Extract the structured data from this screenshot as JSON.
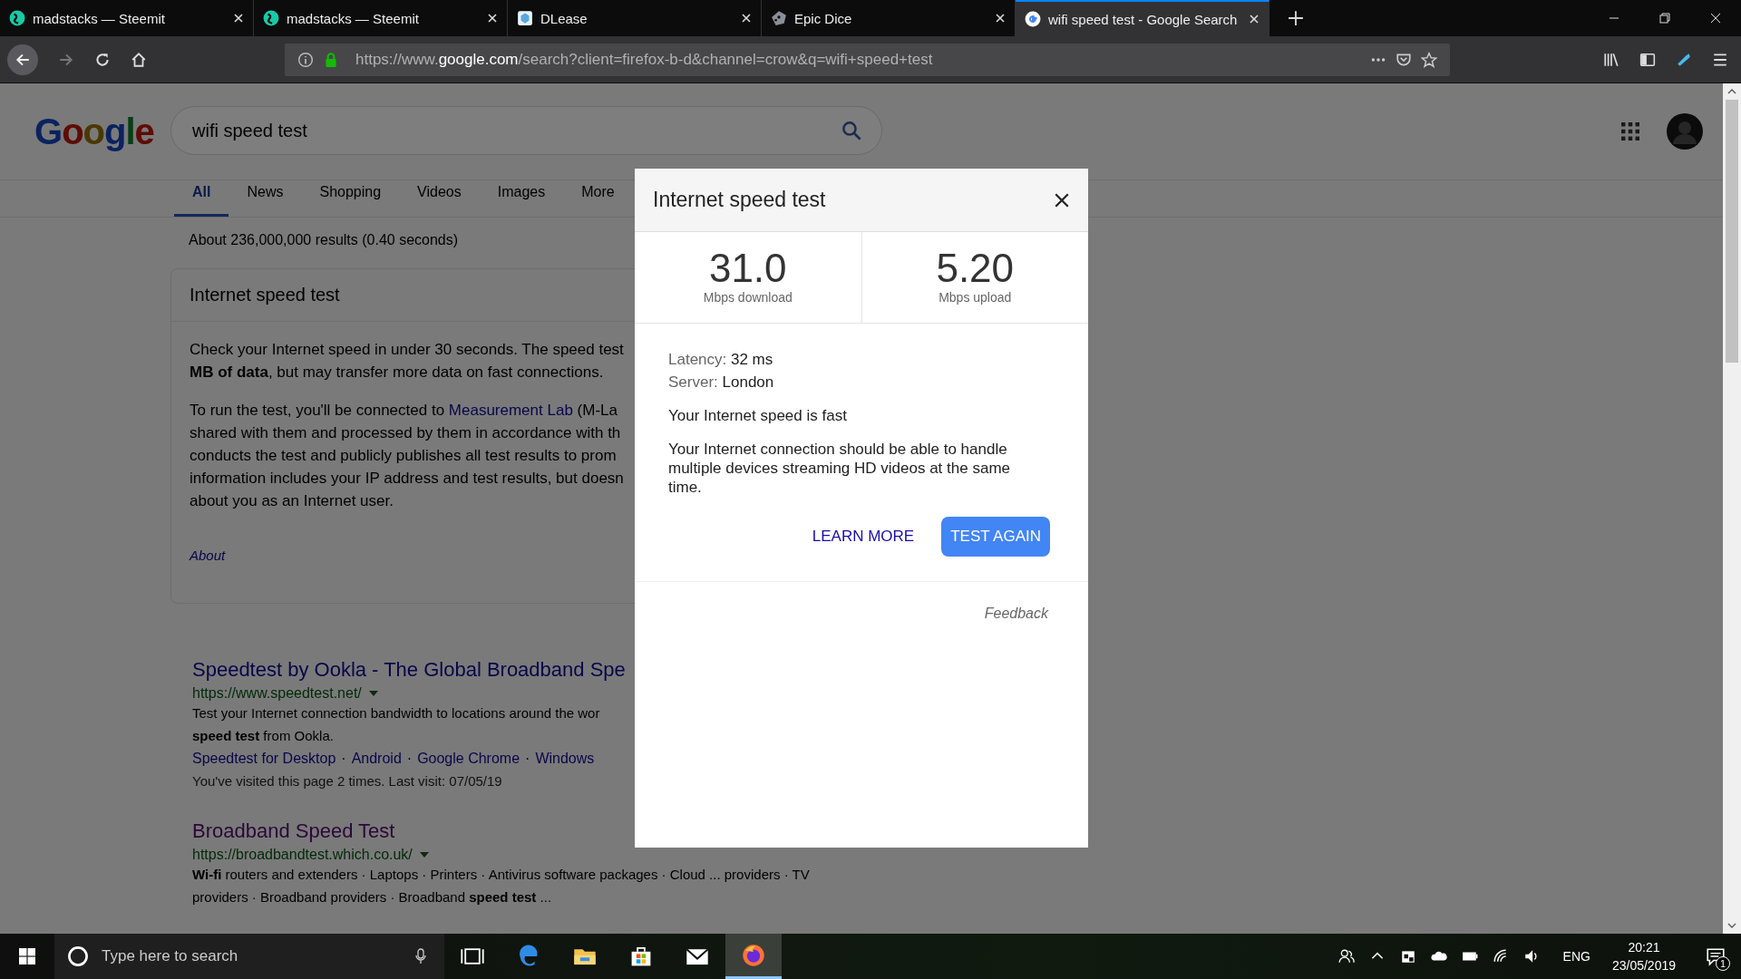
{
  "browser": {
    "tabs": [
      {
        "title": "madstacks — Steemit",
        "selected": false
      },
      {
        "title": "madstacks — Steemit",
        "selected": false
      },
      {
        "title": "DLease",
        "selected": false
      },
      {
        "title": "Epic Dice",
        "selected": false
      },
      {
        "title": "wifi speed test - Google Search",
        "selected": true
      }
    ],
    "url": {
      "prefix": "https://www.",
      "host": "google.com",
      "path": "/search?client=firefox-b-d&channel=crow&q=wifi+speed+test"
    }
  },
  "google": {
    "logo": "Google",
    "query": "wifi speed test",
    "nav_tabs": [
      {
        "label": "All",
        "selected": true
      },
      {
        "label": "News",
        "selected": false
      },
      {
        "label": "Shopping",
        "selected": false
      },
      {
        "label": "Videos",
        "selected": false
      },
      {
        "label": "Images",
        "selected": false
      },
      {
        "label": "More",
        "selected": false
      }
    ],
    "result_stats": "About 236,000,000 results (0.40 seconds)",
    "speed_card": {
      "title": "Internet speed test",
      "paragraph_1": [
        "Check your Internet speed in under 30 seconds. The speed test",
        "**MB of data**, but may transfer more data on fast connections."
      ],
      "paragraph_2_first": {
        "before": "To run the test, you'll be connected to ",
        "link": "Measurement Lab",
        "after": " (M-La"
      },
      "paragraph_2_rest": [
        "shared with them and processed by them in accordance with th",
        "conducts the test and publicly publishes all test results to prom",
        "information includes your IP address and test results, but doesn",
        "about you as an Internet user."
      ],
      "about": "About"
    },
    "sitelink_separator": "·",
    "results": [
      {
        "title": "Speedtest by Ookla - The Global Broadband Spe",
        "url": "https://www.speedtest.net/",
        "snippet": [
          "Test your Internet connection bandwidth to locations around the wor",
          "**speed test** from Ookla."
        ],
        "sitelinks": [
          "Speedtest for Desktop",
          "Android",
          "Google Chrome",
          "Windows"
        ],
        "visited": "You've visited this page 2 times. Last visit: 07/05/19"
      },
      {
        "title": "Broadband Speed Test",
        "url": "https://broadbandtest.which.co.uk/",
        "snippet": [
          "**Wi-fi** routers and extenders · Laptops · Printers · Antivirus software packages · Cloud ... providers · TV",
          "providers · Broadband providers · Broadband **speed test** ..."
        ]
      }
    ]
  },
  "dialog": {
    "title": "Internet speed test",
    "download": {
      "value": "31.0",
      "label": "Mbps download"
    },
    "upload": {
      "value": "5.20",
      "label": "Mbps upload"
    },
    "latency_label": "Latency:",
    "latency": "32 ms",
    "server_label": "Server:",
    "server": "London",
    "verdict": "Your Internet speed is fast",
    "description": "Your Internet connection should be able to handle multiple devices streaming HD videos at the same time.",
    "learn_more": "LEARN MORE",
    "test_again": "TEST AGAIN",
    "feedback": "Feedback"
  },
  "taskbar": {
    "search_placeholder": "Type here to search",
    "apps": [
      {
        "kind": "taskview",
        "selected": false
      },
      {
        "kind": "edge",
        "selected": false
      },
      {
        "kind": "explorer",
        "selected": false
      },
      {
        "kind": "store",
        "selected": false
      },
      {
        "kind": "mail",
        "selected": false
      },
      {
        "kind": "firefox",
        "selected": true
      }
    ],
    "language": "ENG",
    "time": "20:21",
    "date": "23/05/2019",
    "notifications": "1"
  }
}
